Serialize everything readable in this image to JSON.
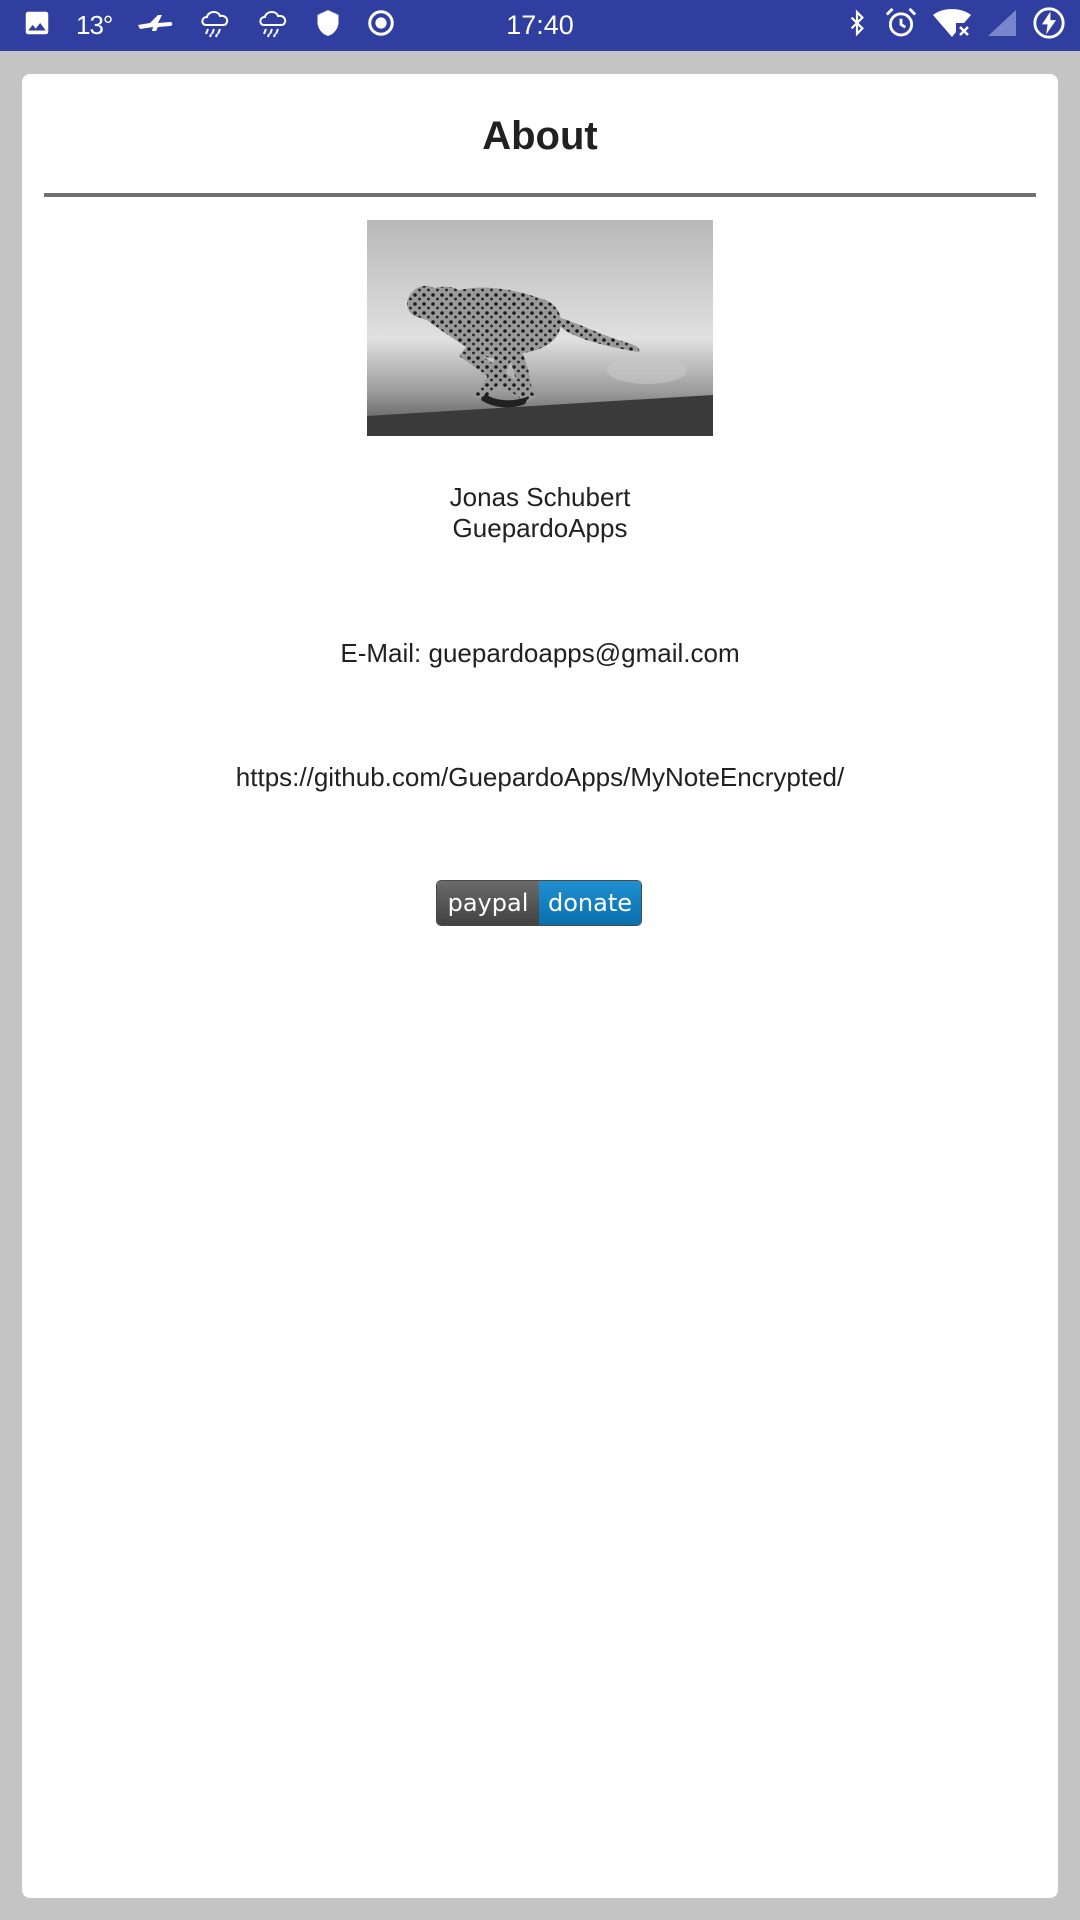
{
  "status_bar": {
    "time": "17:40",
    "temperature": "13°",
    "left_icons": [
      "gallery-icon",
      "airplane-icon",
      "rain-icon",
      "rain-icon",
      "shield-icon",
      "radio-button-icon"
    ],
    "right_icons": [
      "bluetooth-icon",
      "alarm-icon",
      "wifi-off-icon",
      "signal-icon",
      "battery-charging-icon"
    ],
    "background": "#303f9f"
  },
  "about": {
    "title": "About",
    "photo": "cheetah-photo",
    "author_name": "Jonas Schubert",
    "company": "GuepardoApps",
    "email": "E-Mail: guepardoapps@gmail.com",
    "github_url": "https://github.com/GuepardoApps/MyNoteEncrypted/",
    "paypal_label": "paypal",
    "donate_label": "donate"
  },
  "colors": {
    "page_background": "#c4c4c4",
    "card_background": "#ffffff",
    "divider": "#707070",
    "paypal_blue": "#0f7ec0",
    "paypal_gray": "#555555"
  }
}
